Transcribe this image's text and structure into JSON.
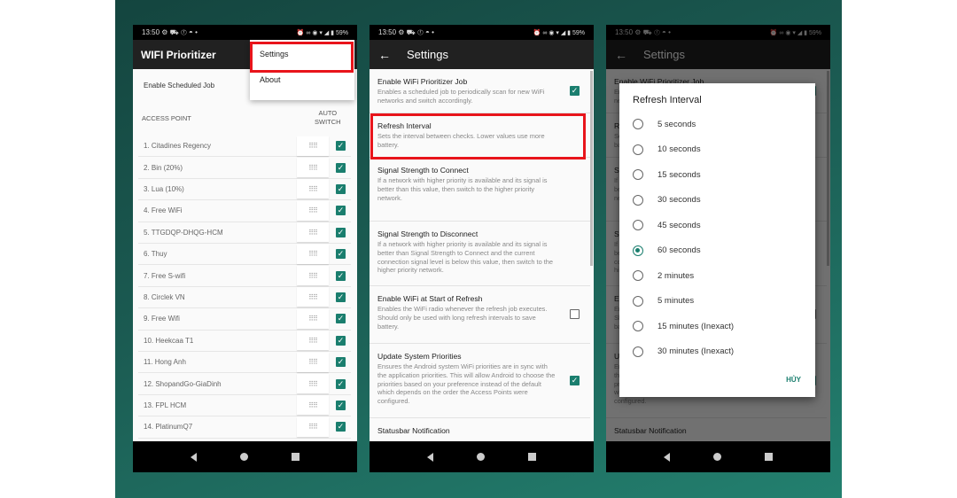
{
  "status_bar": {
    "time": "13:50",
    "left_icons": "⚙ ⛟ ⓕ ◓ •",
    "right_icons": "⏰ ∞ ◉ ▾ ◢ ▮",
    "battery": "59%"
  },
  "screen1": {
    "title": "WIFI Prioritizer",
    "menu": {
      "items": [
        "Settings",
        "About"
      ]
    },
    "enable_label": "Enable Scheduled Job",
    "header_access_point": "ACCESS POINT",
    "header_auto_switch": "AUTO\nSWITCH",
    "access_points": [
      {
        "name": "1. Citadines Regency",
        "auto": true
      },
      {
        "name": "2. Bin (20%)",
        "auto": true
      },
      {
        "name": "3. Lua (10%)",
        "auto": true
      },
      {
        "name": "4. Free WiFi",
        "auto": true
      },
      {
        "name": "5. TTGDQP-DHQG-HCM",
        "auto": true
      },
      {
        "name": "6. Thuy",
        "auto": true
      },
      {
        "name": "7. Free S-wifi",
        "auto": true
      },
      {
        "name": "8. Circlek VN",
        "auto": true
      },
      {
        "name": "9. Free Wifi",
        "auto": true
      },
      {
        "name": "10. Heekcaa T1",
        "auto": true
      },
      {
        "name": "11. Hong Anh",
        "auto": true
      },
      {
        "name": "12. ShopandGo-GiaDinh",
        "auto": true
      },
      {
        "name": "13. FPL HCM",
        "auto": true
      },
      {
        "name": "14. PlatinumQ7",
        "auto": true
      }
    ]
  },
  "settings": {
    "title": "Settings",
    "items": [
      {
        "title": "Enable WiFi Prioritizer Job",
        "summary": "Enables a scheduled job to periodically scan for new WiFi networks and switch accordingly.",
        "checkbox": true
      },
      {
        "title": "Refresh Interval",
        "summary": "Sets the interval between checks. Lower values use more battery.",
        "checkbox": null
      },
      {
        "title": "Signal Strength to Connect",
        "summary": "If a network with higher priority is available and its signal is better than this value, then switch to the higher priority network.",
        "checkbox": null
      },
      {
        "title": "Signal Strength to Disconnect",
        "summary": "If a network with higher priority is available and its signal is better than Signal Strength to Connect and the current connection signal level is below this value, then switch to the higher priority network.",
        "checkbox": null
      },
      {
        "title": "Enable WiFi at Start of Refresh",
        "summary": "Enables the WiFi radio whenever the refresh job executes. Should only be used with long refresh intervals to save battery.",
        "checkbox": false
      },
      {
        "title": "Update System Priorities",
        "summary": "Ensures the Android system WiFi priorities are in sync with the application priorities. This will allow Android to choose the priorities based on your preference instead of the default which depends on the order the Access Points were configured.",
        "checkbox": true
      },
      {
        "title": "Statusbar Notification",
        "summary": "",
        "checkbox": null
      }
    ]
  },
  "dialog": {
    "title": "Refresh Interval",
    "options": [
      "5 seconds",
      "10 seconds",
      "15 seconds",
      "30 seconds",
      "45 seconds",
      "60 seconds",
      "2 minutes",
      "5 minutes",
      "15 minutes (Inexact)",
      "30 minutes (Inexact)"
    ],
    "selected": "60 seconds",
    "cancel": "HỦY"
  },
  "colors": {
    "accent": "#1a7e6e",
    "highlight": "#e8141b",
    "appbar": "#212121"
  }
}
